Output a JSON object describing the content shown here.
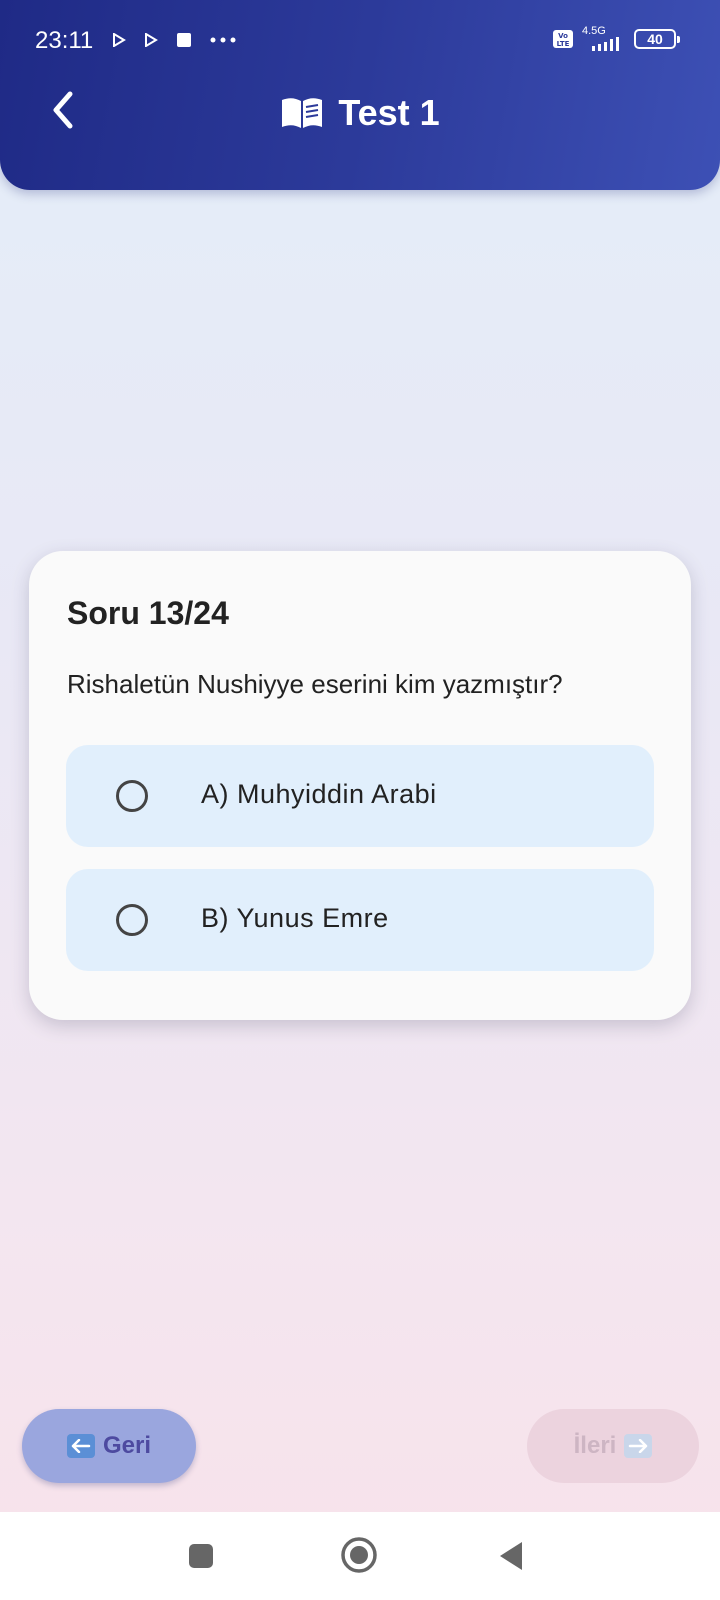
{
  "status_bar": {
    "time": "23:11",
    "network": "4.5G",
    "volte": "Vo LTE",
    "battery": "40"
  },
  "header": {
    "title": "Test 1",
    "back_icon": "chevron-left-icon",
    "title_icon": "book-icon"
  },
  "question": {
    "counter": "Soru 13/24",
    "text": "Rishaletün Nushiyye eserini kim yazmıştır?",
    "options": [
      {
        "label": "A) Muhyiddin Arabi",
        "selected": false
      },
      {
        "label": "B) Yunus Emre",
        "selected": false
      }
    ]
  },
  "navigation": {
    "prev_label": "Geri",
    "next_label": "İleri",
    "next_enabled": false
  },
  "colors": {
    "header_start": "#1f2a86",
    "header_end": "#3d50b5",
    "option_bg": "#e1effc",
    "prev_button": "#9aa6de",
    "next_button_disabled": "#ecd3de"
  }
}
